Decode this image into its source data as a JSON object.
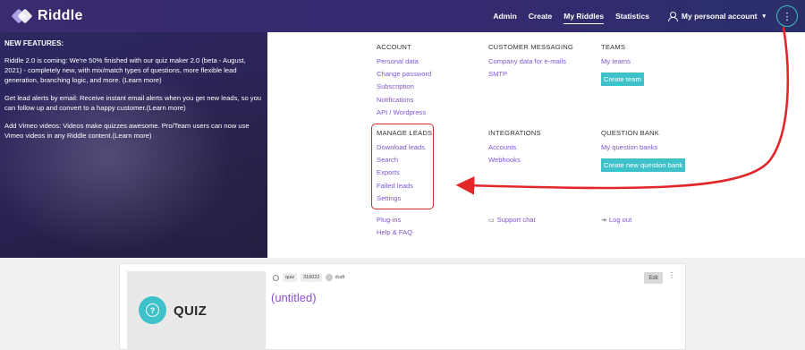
{
  "brand": {
    "name": "Riddle"
  },
  "nav": {
    "links": [
      {
        "label": "Admin"
      },
      {
        "label": "Create"
      },
      {
        "label": "My Riddles"
      },
      {
        "label": "Statistics"
      }
    ],
    "account_label": "My personal account",
    "kebab_label": "⋮"
  },
  "features": {
    "title": "NEW FEATURES:",
    "paragraphs": [
      "Riddle 2.0 is coming: We're 50% finished with our quiz maker 2.0 (beta - August, 2021) - completely new, with mix/match types of questions, more flexible lead generation, branching logic, and more. (Learn more)",
      "Get lead alerts by email: Receive instant email alerts when you get new leads, so you can follow up and convert to a happy customer.(Learn more)",
      "Add Vimeo videos: Videos make quizzes awesome. Pro/Team users can now use Vimeo videos in any Riddle content.(Learn more)"
    ]
  },
  "menu": {
    "account": {
      "heading": "ACCOUNT",
      "items": [
        "Personal data",
        "Change password",
        "Subscription",
        "Notifications",
        "API / Wordpress"
      ]
    },
    "customer_messaging": {
      "heading": "CUSTOMER MESSAGING",
      "items": [
        "Company data for e-mails",
        "SMTP"
      ]
    },
    "teams": {
      "heading": "TEAMS",
      "items": [
        "My teams"
      ],
      "button": "Create team"
    },
    "manage_leads": {
      "heading": "MANAGE LEADS",
      "items": [
        "Download leads",
        "Search",
        "Exports",
        "Failed leads",
        "Settings"
      ]
    },
    "integrations": {
      "heading": "INTEGRATIONS",
      "items": [
        "Accounts",
        "Webhooks"
      ]
    },
    "question_bank": {
      "heading": "QUESTION BANK",
      "items": [
        "My question banks"
      ],
      "button": "Create new question bank"
    },
    "footer": {
      "plugins": "Plug-ins",
      "help": "Help & FAQ",
      "support_chat": "Support chat",
      "logout": "Log out"
    }
  },
  "card": {
    "thumb_label": "QUIZ",
    "type_chip": "quiz",
    "id_chip": "316022",
    "status": "draft",
    "title": "(untitled)",
    "edit_label": "Edit",
    "more_label": "⋮"
  },
  "colors": {
    "accent_teal": "#3ec1c9",
    "link_purple": "#7f56d9",
    "highlight_red": "#d62b2b"
  }
}
